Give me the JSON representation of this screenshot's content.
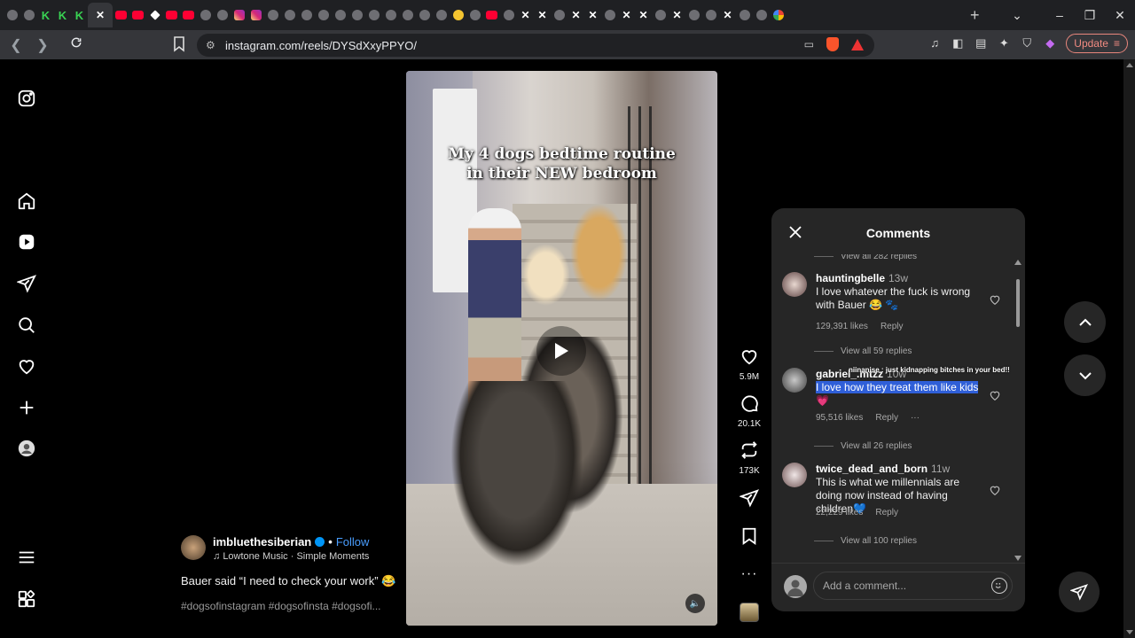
{
  "browser": {
    "url": "instagram.com/reels/DYSdXxyPPYO/",
    "update_label": "Update",
    "tab_favicons": [
      "generic",
      "generic",
      "k",
      "k",
      "k",
      "active-x",
      "youtube",
      "youtube",
      "diamond",
      "youtube",
      "youtube",
      "generic",
      "generic",
      "instagram",
      "instagram",
      "generic",
      "generic",
      "generic",
      "generic",
      "generic",
      "generic",
      "generic",
      "generic",
      "generic",
      "generic",
      "generic",
      "emoji",
      "generic",
      "youtube",
      "generic",
      "x",
      "x",
      "generic",
      "x",
      "x",
      "generic",
      "x",
      "x",
      "generic",
      "x",
      "generic",
      "generic",
      "x",
      "generic",
      "generic",
      "google"
    ]
  },
  "left_nav": [
    "instagram-logo-icon",
    "home-icon",
    "reels-icon",
    "messages-icon",
    "search-icon",
    "notifications-icon",
    "create-icon",
    "profile-icon",
    "more-menu-icon",
    "also-from-meta-icon"
  ],
  "reel": {
    "caption_overlay_line1": "My 4 dogs bedtime routine",
    "caption_overlay_line2": "in their NEW bedroom",
    "author": "imbluethesiberian",
    "follow_label": "Follow",
    "music": "Lowtone Music · Simple Moments",
    "caption": "Bauer said “I need to check your work” 😂",
    "hashtags": "#dogsofinstagram #dogsofinsta #dogsofi..."
  },
  "actions": {
    "likes": "5.9M",
    "comments": "20.1K",
    "reposts": "173K"
  },
  "comments_panel": {
    "title": "Comments",
    "top_view_replies": "View all 282 replies",
    "items": [
      {
        "username": "hauntingbelle",
        "time": "13w",
        "text": "I love whatever the fuck is wrong with Bauer 😂 🐾",
        "likes": "129,391 likes",
        "reply": "Reply",
        "view_replies": "View all 59 replies"
      },
      {
        "username": "gabriel_.mtzz",
        "time": "10w",
        "text_selected": "I love how they treat them like kids",
        "text_tail": "💗",
        "overlay": "niinanise : just kidnapping bitches in your bed!!",
        "likes": "95,516 likes",
        "reply": "Reply",
        "more": "···",
        "view_replies": "View all 26 replies"
      },
      {
        "username": "twice_dead_and_born",
        "time": "11w",
        "text": "This is what we millennials are doing now instead of having children💙",
        "likes": "22,229 likes",
        "reply": "Reply",
        "view_replies": "View all 100 replies"
      }
    ],
    "add_comment_placeholder": "Add a comment..."
  }
}
